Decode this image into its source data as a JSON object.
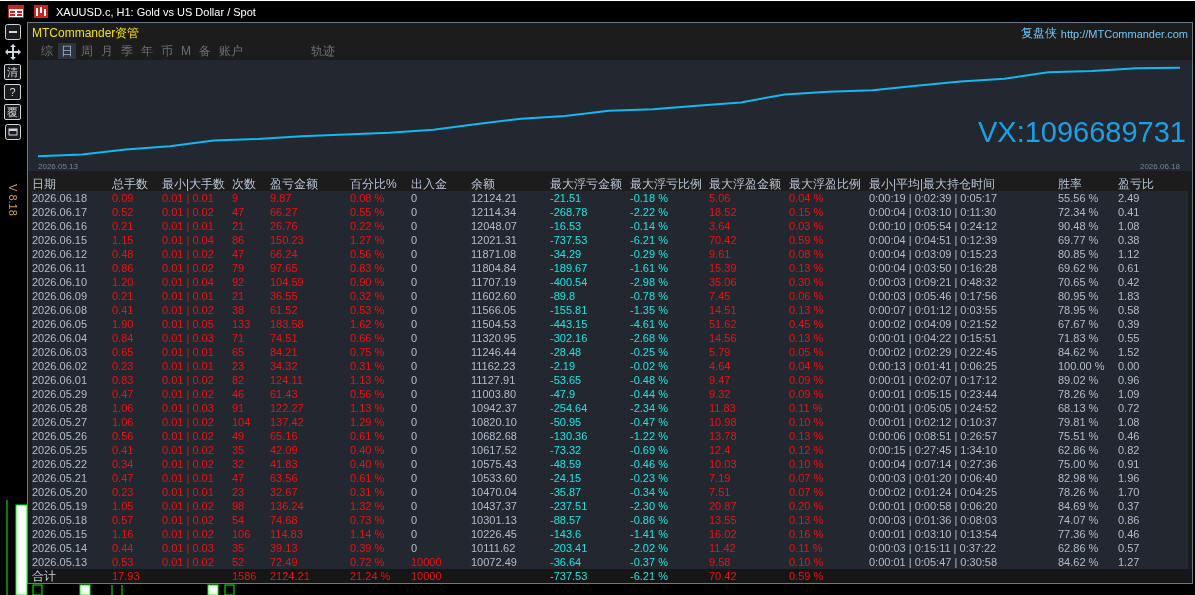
{
  "window": {
    "title": "XAUUSD.c, H1:  Gold vs US Dollar / Spot"
  },
  "toolbar": {
    "buttons": [
      {
        "kind": "minus"
      },
      {
        "kind": "move"
      },
      {
        "kind": "text",
        "label": "清"
      },
      {
        "kind": "text",
        "label": "?"
      },
      {
        "kind": "text",
        "label": "覆"
      },
      {
        "kind": "window"
      }
    ],
    "version": "V 8.18"
  },
  "panel": {
    "brand": "MTCommander资管",
    "replay_label": "复盘侠",
    "url": "http://MTCommander.com",
    "tabs": [
      {
        "label": "综",
        "selected": false
      },
      {
        "label": "日",
        "selected": true
      },
      {
        "label": "周",
        "selected": false
      },
      {
        "label": "月",
        "selected": false
      },
      {
        "label": "季",
        "selected": false
      },
      {
        "label": "年",
        "selected": false
      },
      {
        "label": "币",
        "selected": false
      },
      {
        "label": "M",
        "selected": false
      },
      {
        "label": "备",
        "selected": false
      },
      {
        "label": "账户",
        "selected": false
      },
      {
        "label": "轨迹",
        "selected": false
      }
    ],
    "chart": {
      "start_label": "2026.05.13",
      "end_label": "2026.06.18",
      "overlay": "VX:1096689731"
    }
  },
  "table": {
    "columns": [
      "日期",
      "总手数",
      "最小|大手数",
      "次数",
      "盈亏金额",
      "百分比%",
      "出入金",
      "余额",
      "最大浮亏金额",
      "最大浮亏比例",
      "最大浮盈金额",
      "最大浮盈比例",
      "最小|平均|最大持仓时间",
      "胜率",
      "盈亏比"
    ],
    "rows": [
      [
        "2026.06.18",
        "0.09",
        "0.01 | 0.01",
        "9",
        "9.87",
        "0.08 %",
        "0",
        "12124.21",
        "-21.51",
        "-0.18 %",
        "5.06",
        "0.04 %",
        "0:00:19 | 0:02:39 | 0:05:17",
        "55.56 %",
        "2.49"
      ],
      [
        "2026.06.17",
        "0.52",
        "0.01 | 0.02",
        "47",
        "66.27",
        "0.55 %",
        "0",
        "12114.34",
        "-268.78",
        "-2.22 %",
        "18.52",
        "0.15 %",
        "0:00:04 | 0:03:10 | 0:11:30",
        "72.34 %",
        "0.41"
      ],
      [
        "2026.06.16",
        "0.21",
        "0.01 | 0.01",
        "21",
        "26.76",
        "0.22 %",
        "0",
        "12048.07",
        "-16.53",
        "-0.14 %",
        "3.64",
        "0.03 %",
        "0:00:10 | 0:05:54 | 0:24:12",
        "90.48 %",
        "1.08"
      ],
      [
        "2026.06.15",
        "1.15",
        "0.01 | 0.04",
        "86",
        "150.23",
        "1.27 %",
        "0",
        "12021.31",
        "-737.53",
        "-6.21 %",
        "70.42",
        "0.59 %",
        "0:00:04 | 0:04:51 | 0:12:39",
        "69.77 %",
        "0.38"
      ],
      [
        "2026.06.12",
        "0.48",
        "0.01 | 0.02",
        "47",
        "66.24",
        "0.56 %",
        "0",
        "11871.08",
        "-34.29",
        "-0.29 %",
        "9.61",
        "0.08 %",
        "0:00:04 | 0:03:09 | 0:15:23",
        "80.85 %",
        "1.12"
      ],
      [
        "2026.06.11",
        "0.86",
        "0.01 | 0.02",
        "79",
        "97.65",
        "0.83 %",
        "0",
        "11804.84",
        "-189.67",
        "-1.61 %",
        "15.39",
        "0.13 %",
        "0:00:04 | 0:03:50 | 0:16:28",
        "69.62 %",
        "0.61"
      ],
      [
        "2026.06.10",
        "1.20",
        "0.01 | 0.04",
        "92",
        "104.59",
        "0.90 %",
        "0",
        "11707.19",
        "-400.54",
        "-2.98 %",
        "35.06",
        "0.30 %",
        "0:00:03 | 0:09:21 | 0:48:32",
        "70.65 %",
        "0.42"
      ],
      [
        "2026.06.09",
        "0.21",
        "0.01 | 0.01",
        "21",
        "36.55",
        "0.32 %",
        "0",
        "11602.60",
        "-89.8",
        "-0.78 %",
        "7.45",
        "0.06 %",
        "0:00:03 | 0:05:46 | 0:17:56",
        "80.95 %",
        "1.83"
      ],
      [
        "2026.06.08",
        "0.41",
        "0.01 | 0.02",
        "38",
        "61.52",
        "0.53 %",
        "0",
        "11566.05",
        "-155.81",
        "-1.35 %",
        "14.51",
        "0.13 %",
        "0:00:07 | 0:01:12 | 0:03:55",
        "78.95 %",
        "0.58"
      ],
      [
        "2026.06.05",
        "1.90",
        "0.01 | 0.05",
        "133",
        "183.58",
        "1.62 %",
        "0",
        "11504.53",
        "-443.15",
        "-4.61 %",
        "51.62",
        "0.45 %",
        "0:00:02 | 0:04:09 | 0:21:52",
        "67.67 %",
        "0.39"
      ],
      [
        "2026.06.04",
        "0.84",
        "0.01 | 0.03",
        "71",
        "74.51",
        "0.66 %",
        "0",
        "11320.95",
        "-302.16",
        "-2.68 %",
        "14.56",
        "0.13 %",
        "0:00:01 | 0:04:22 | 0:15:51",
        "71.83 %",
        "0.55"
      ],
      [
        "2026.06.03",
        "0.65",
        "0.01 | 0.01",
        "65",
        "84.21",
        "0.75 %",
        "0",
        "11246.44",
        "-28.48",
        "-0.25 %",
        "5.79",
        "0.05 %",
        "0:00:02 | 0:02:29 | 0:22:45",
        "84.62 %",
        "1.52"
      ],
      [
        "2026.06.02",
        "0.23",
        "0.01 | 0.01",
        "23",
        "34.32",
        "0.31 %",
        "0",
        "11162.23",
        "-2.19",
        "-0.02 %",
        "4.64",
        "0.04 %",
        "0:00:13 | 0:01:41 | 0:06:25",
        "100.00 %",
        "0.00"
      ],
      [
        "2026.06.01",
        "0.83",
        "0.01 | 0.02",
        "82",
        "124.11",
        "1.13 %",
        "0",
        "11127.91",
        "-53.65",
        "-0.48 %",
        "9.47",
        "0.09 %",
        "0:00:01 | 0:02:07 | 0:17:12",
        "89.02 %",
        "0.96"
      ],
      [
        "2026.05.29",
        "0.47",
        "0.01 | 0.02",
        "46",
        "61.43",
        "0.56 %",
        "0",
        "11003.80",
        "-47.9",
        "-0.44 %",
        "9.32",
        "0.09 %",
        "0:00:01 | 0:05:15 | 0:23:44",
        "78.26 %",
        "1.09"
      ],
      [
        "2026.05.28",
        "1.06",
        "0.01 | 0.03",
        "91",
        "122.27",
        "1.13 %",
        "0",
        "10942.37",
        "-254.64",
        "-2.34 %",
        "11.83",
        "0.11 %",
        "0:00:01 | 0:05:05 | 0:24:52",
        "68.13 %",
        "0.72"
      ],
      [
        "2026.05.27",
        "1.06",
        "0.01 | 0.02",
        "104",
        "137.42",
        "1.29 %",
        "0",
        "10820.10",
        "-50.95",
        "-0.47 %",
        "10.98",
        "0.10 %",
        "0:00:01 | 0:02:12 | 0:10:37",
        "79.81 %",
        "1.08"
      ],
      [
        "2026.05.26",
        "0.56",
        "0.01 | 0.02",
        "49",
        "65.16",
        "0.61 %",
        "0",
        "10682.68",
        "-130.36",
        "-1.22 %",
        "13.78",
        "0.13 %",
        "0:00:06 | 0:08:51 | 0:26:57",
        "75.51 %",
        "0.46"
      ],
      [
        "2026.05.25",
        "0.41",
        "0.01 | 0.02",
        "35",
        "42.09",
        "0.40 %",
        "0",
        "10617.52",
        "-73.32",
        "-0.69 %",
        "12.4",
        "0.12 %",
        "0:00:15 | 0:27:45 | 1:34:10",
        "62.86 %",
        "0.82"
      ],
      [
        "2026.05.22",
        "0.34",
        "0.01 | 0.02",
        "32",
        "41.83",
        "0.40 %",
        "0",
        "10575.43",
        "-48.59",
        "-0.46 %",
        "10.03",
        "0.10 %",
        "0:00:04 | 0:07:14 | 0:27:36",
        "75.00 %",
        "0.91"
      ],
      [
        "2026.05.21",
        "0.47",
        "0.01 | 0.01",
        "47",
        "63.56",
        "0.61 %",
        "0",
        "10533.60",
        "-24.15",
        "-0.23 %",
        "7.19",
        "0.07 %",
        "0:00:03 | 0:01:20 | 0:06:40",
        "82.98 %",
        "1.96"
      ],
      [
        "2026.05.20",
        "0.23",
        "0.01 | 0.01",
        "23",
        "32.67",
        "0.31 %",
        "0",
        "10470.04",
        "-35.87",
        "-0.34 %",
        "7.51",
        "0.07 %",
        "0:00:02 | 0:01:24 | 0:04:25",
        "78.26 %",
        "1.70"
      ],
      [
        "2026.05.19",
        "1.05",
        "0.01 | 0.02",
        "98",
        "136.24",
        "1.32 %",
        "0",
        "10437.37",
        "-237.51",
        "-2.30 %",
        "20.87",
        "0.20 %",
        "0:00:01 | 0:00:58 | 0:06:20",
        "84.69 %",
        "0.37"
      ],
      [
        "2026.05.18",
        "0.57",
        "0.01 | 0.02",
        "54",
        "74.68",
        "0.73 %",
        "0",
        "10301.13",
        "-88.57",
        "-0.86 %",
        "13.55",
        "0.13 %",
        "0:00:03 | 0:01:36 | 0:08:03",
        "74.07 %",
        "0.86"
      ],
      [
        "2026.05.15",
        "1.16",
        "0.01 | 0.02",
        "106",
        "114.83",
        "1.14 %",
        "0",
        "10226.45",
        "-143.6",
        "-1.41 %",
        "16.02",
        "0.16 %",
        "0:00:01 | 0:03:10 | 0:13:54",
        "77.36 %",
        "0.46"
      ],
      [
        "2026.05.14",
        "0.44",
        "0.01 | 0.03",
        "35",
        "39.13",
        "0.39 %",
        "0",
        "10111.62",
        "-203.41",
        "-2.02 %",
        "11.42",
        "0.11 %",
        "0:00:03 | 0:15:11 | 0:37:22",
        "62.86 %",
        "0.57"
      ],
      [
        "2026.05.13",
        "0.53",
        "0.01 | 0.02",
        "52",
        "72.49",
        "0.72 %",
        "10000",
        "10072.49",
        "-36.64",
        "-0.37 %",
        "9.58",
        "0.10 %",
        "0:00:01 | 0:05:47 | 0:30:58",
        "84.62 %",
        "1.27"
      ]
    ],
    "total": {
      "date": "合计",
      "lots": "17.93",
      "count": "1586",
      "pnl": "2124.21",
      "pct": "21.24 %",
      "deposit": "10000",
      "float_loss": "-737.53",
      "float_loss_pct": "-6.21 %",
      "float_gain": "70.42",
      "float_gain_pct": "0.59 %"
    }
  }
}
